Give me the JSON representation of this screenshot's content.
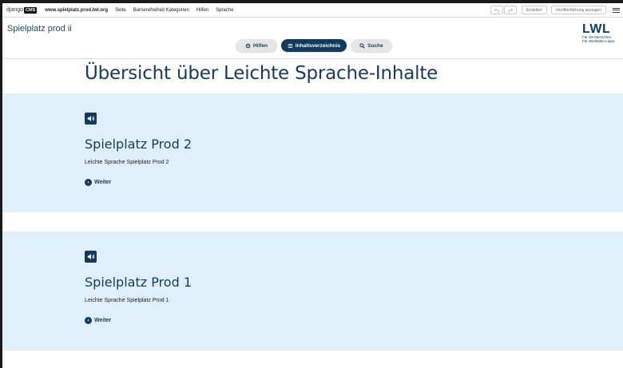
{
  "toolbar": {
    "logo_django": "django",
    "logo_cms": "CMS",
    "domain": "www.spielplatz.prod.lwl.org",
    "menu": [
      "Seite",
      "Barrierefreiheit Kategorien",
      "Hilfen",
      "Sprache"
    ],
    "undo_icon": "undo-icon",
    "redo_icon": "redo-icon",
    "create_label": "Erstellen",
    "publish_label": "Veröffentlichung anzeigen",
    "menu_icon": "hamburger-menu-icon"
  },
  "header": {
    "site_title": "Spielplatz prod ii",
    "logo": {
      "word": "LWL",
      "line1": "Für die Menschen.",
      "line2": "Für Westfalen-Lippe."
    },
    "nav": [
      {
        "label": "Hilfen",
        "icon": "gear-icon",
        "active": false
      },
      {
        "label": "Inhaltsverzeichnis",
        "icon": "list-icon",
        "active": true
      },
      {
        "label": "Suche",
        "icon": "search-icon",
        "active": false
      }
    ]
  },
  "main": {
    "heading": "Übersicht über Leichte Sprache-Inhalte",
    "cards": [
      {
        "title": "Spielplatz Prod 2",
        "description": "Leichte Sprache Spielplatz Prod 2",
        "link_label": "Weiter",
        "audio_icon": "speaker-icon"
      },
      {
        "title": "Spielplatz Prod 1",
        "description": "Leichte Sprache Spielplatz Prod 1",
        "link_label": "Weiter",
        "audio_icon": "speaker-icon"
      }
    ]
  },
  "colors": {
    "brand": "#163a5f",
    "card_bg": "#dff0fb"
  }
}
